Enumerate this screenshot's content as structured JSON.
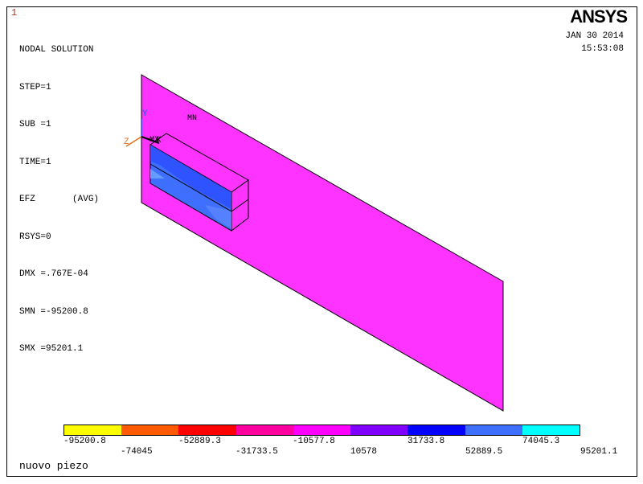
{
  "window_number": "1",
  "brand": "ANSYS",
  "info": {
    "title": "NODAL SOLUTION",
    "step": "STEP=1",
    "sub": "SUB =1",
    "time": "TIME=1",
    "efz": "EFZ       (AVG)",
    "rsys": "RSYS=0",
    "dmx": "DMX =.767E-04",
    "smn": "SMN =-95200.8",
    "smx": "SMX =95201.1"
  },
  "date": "JAN 30 2014",
  "time_of_day": "15:53:08",
  "markers": {
    "mn": "MN",
    "mx": "MX"
  },
  "axes": {
    "y": "Y",
    "z": "Z",
    "x": "X"
  },
  "legend": {
    "colors": [
      "#ffff00",
      "#ff5a00",
      "#ff0000",
      "#ff00a0",
      "#ff00ff",
      "#7f00ff",
      "#0000ff",
      "#3f6fff",
      "#00ffff"
    ],
    "labels": [
      "-95200.8",
      "-74045",
      "-52889.3",
      "-31733.5",
      "-10577.8",
      "10578",
      "31733.8",
      "52889.5",
      "74045.3",
      "95201.1"
    ]
  },
  "plot_title": "nuovo piezo"
}
